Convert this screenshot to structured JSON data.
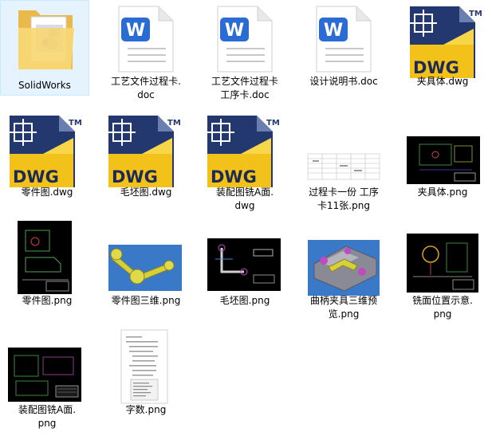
{
  "files": [
    {
      "id": "f1",
      "name_lines": [
        "SolidWorks"
      ],
      "type": "folder",
      "selected": true
    },
    {
      "id": "f2",
      "name_lines": [
        "工艺文件过程卡.",
        "doc"
      ],
      "type": "doc"
    },
    {
      "id": "f3",
      "name_lines": [
        "工艺文件过程卡",
        "工序卡.doc"
      ],
      "type": "doc"
    },
    {
      "id": "f4",
      "name_lines": [
        "设计说明书.doc"
      ],
      "type": "doc"
    },
    {
      "id": "f5",
      "name_lines": [
        "夹具体.dwg"
      ],
      "type": "dwg"
    },
    {
      "id": "f6",
      "name_lines": [
        "零件图.dwg"
      ],
      "type": "dwg"
    },
    {
      "id": "f7",
      "name_lines": [
        "毛坯图.dwg"
      ],
      "type": "dwg"
    },
    {
      "id": "f8",
      "name_lines": [
        "装配图铣A面.",
        "dwg"
      ],
      "type": "dwg"
    },
    {
      "id": "f9",
      "name_lines": [
        "过程卡一份 工序",
        "卡11张.png"
      ],
      "type": "png-table"
    },
    {
      "id": "f10",
      "name_lines": [
        "夹具体.png"
      ],
      "type": "png-cad-dark"
    },
    {
      "id": "f11",
      "name_lines": [
        "零件图.png"
      ],
      "type": "png-cad-tall"
    },
    {
      "id": "f12",
      "name_lines": [
        "零件图三维.png"
      ],
      "type": "png-3d-part"
    },
    {
      "id": "f13",
      "name_lines": [
        "毛坯图.png"
      ],
      "type": "png-cad-part"
    },
    {
      "id": "f14",
      "name_lines": [
        "曲柄夹具三维预",
        "览.png"
      ],
      "type": "png-3d-fixture"
    },
    {
      "id": "f15",
      "name_lines": [
        "铣面位置示意.",
        "png"
      ],
      "type": "png-cad-circle"
    },
    {
      "id": "f16",
      "name_lines": [
        "装配图铣A面.",
        "png"
      ],
      "type": "png-cad-assy"
    },
    {
      "id": "f17",
      "name_lines": [
        "字数.png"
      ],
      "type": "png-doc"
    }
  ],
  "icons": {
    "word_letter": "W",
    "dwg_text": "DWG",
    "dwg_tm": "TM"
  },
  "colors": {
    "selection": "#e5f3ff",
    "word_blue": "#2b6cd4",
    "dwg_navy": "#22386e",
    "dwg_yellow": "#f2c21b",
    "folder_yellow": "#f7d774"
  }
}
